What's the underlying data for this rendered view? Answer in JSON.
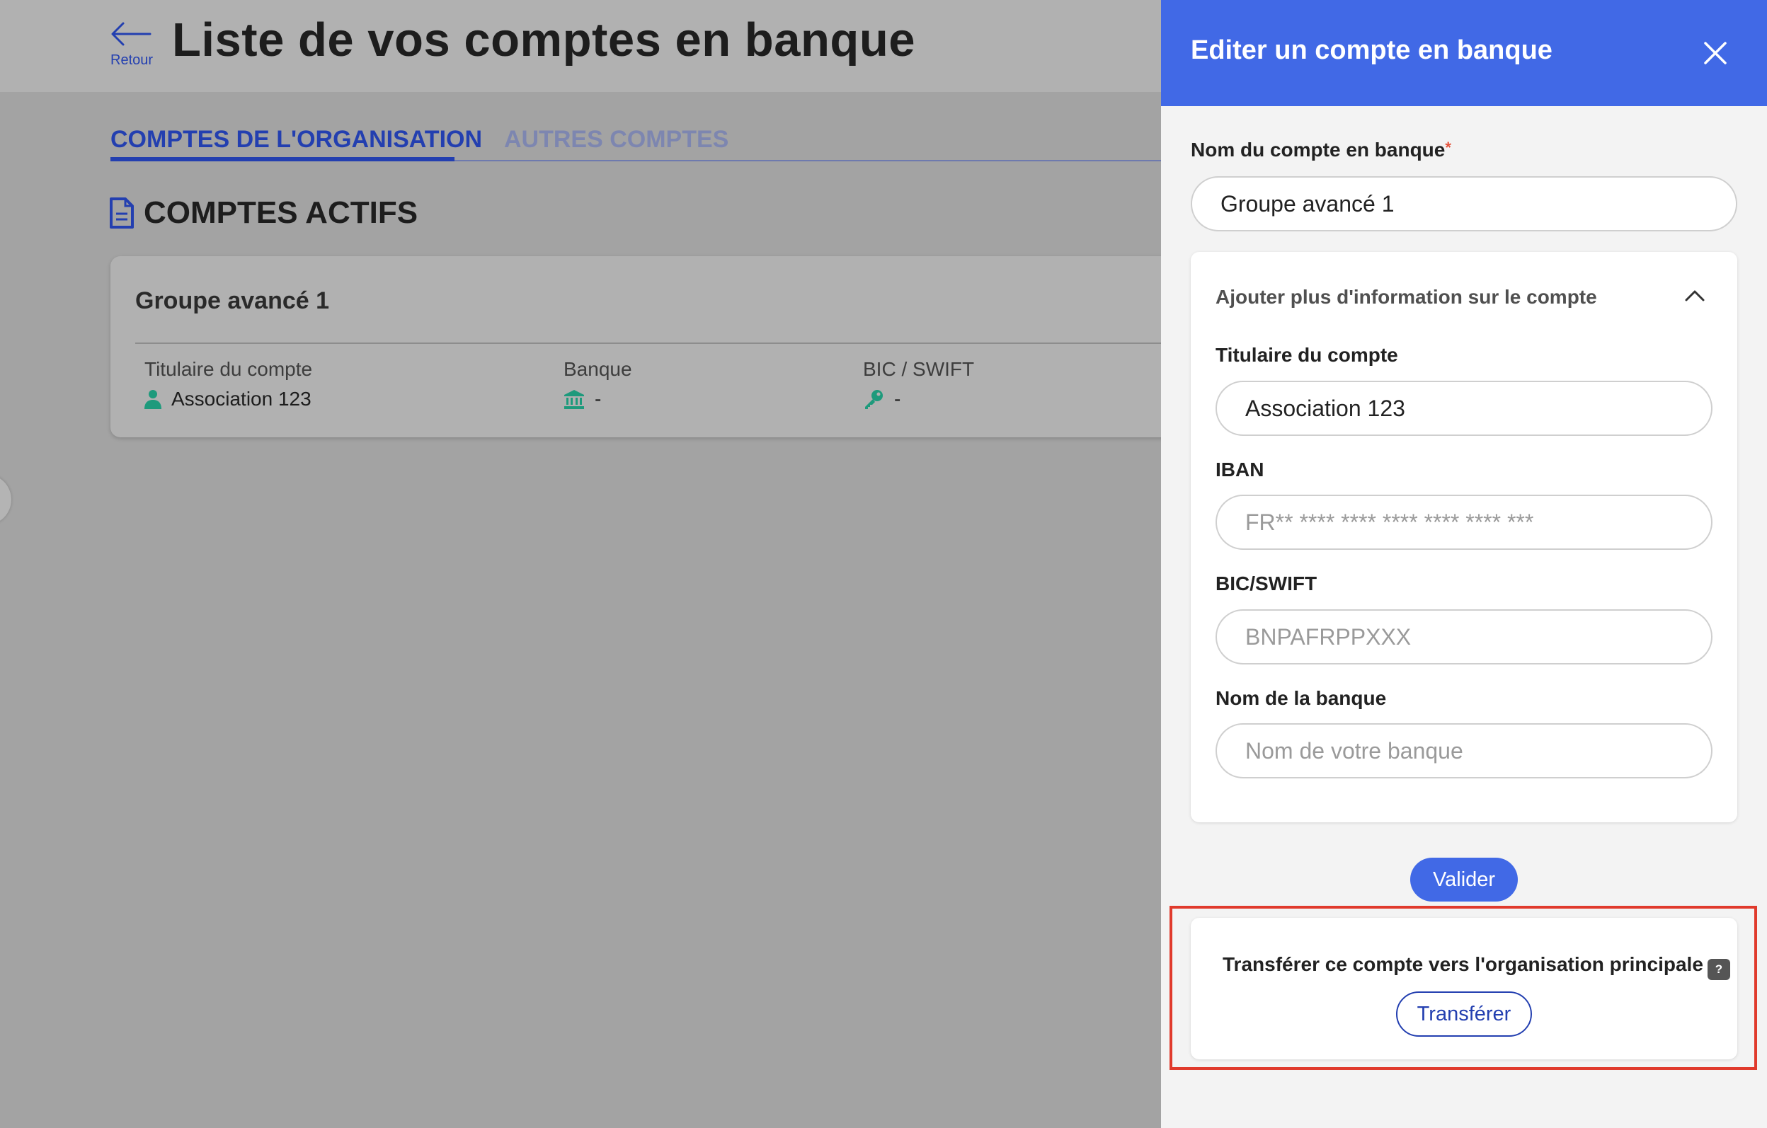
{
  "header": {
    "back_label": "Retour",
    "title": "Liste de vos comptes en banque"
  },
  "tabs": [
    {
      "label": "COMPTES DE L'ORGANISATION",
      "active": true
    },
    {
      "label": "AUTRES COMPTES",
      "active": false
    }
  ],
  "section": {
    "icon": "document-icon",
    "title": "COMPTES ACTIFS"
  },
  "account_card": {
    "name": "Groupe avancé 1",
    "columns": [
      {
        "label": "Titulaire du compte",
        "value": "Association 123",
        "icon": "user-icon"
      },
      {
        "label": "Banque",
        "value": "-",
        "icon": "bank-icon"
      },
      {
        "label": "BIC / SWIFT",
        "value": "-",
        "icon": "key-icon"
      }
    ]
  },
  "drawer": {
    "title": "Editer un compte en banque",
    "account_name_label": "Nom du compte en banque",
    "required_marker": "*",
    "account_name_value": "Groupe avancé 1",
    "more_info_toggle": "Ajouter plus d'information sur le compte",
    "holder_label": "Titulaire du compte",
    "holder_value": "Association 123",
    "iban_label": "IBAN",
    "iban_placeholder": "FR** **** **** **** **** **** ***",
    "bic_label": "BIC/SWIFT",
    "bic_placeholder": "BNPAFRPPXXX",
    "bank_name_label": "Nom de la banque",
    "bank_name_placeholder": "Nom de votre banque",
    "submit_label": "Valider",
    "transfer_text": "Transférer ce compte vers l'organisation principale",
    "help_badge": "?",
    "transfer_button": "Transférer"
  },
  "colors": {
    "primary": "#4169e6",
    "tab_active": "#233fb0",
    "highlight": "#e03a2c",
    "icon_teal": "#1e9a7c"
  }
}
